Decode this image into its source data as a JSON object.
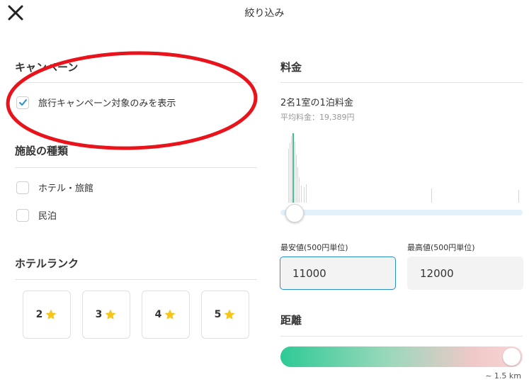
{
  "header": {
    "title": "絞り込み"
  },
  "campaign": {
    "title": "キャンペーン",
    "option_label": "旅行キャンペーン対象のみを表示",
    "checked": true
  },
  "facility": {
    "title": "施設の種類",
    "options": [
      {
        "label": "ホテル・旅館",
        "checked": false
      },
      {
        "label": "民泊",
        "checked": false
      }
    ]
  },
  "rank": {
    "title": "ホテルランク",
    "options": [
      "2",
      "3",
      "4",
      "5"
    ]
  },
  "price": {
    "title": "料金",
    "subtitle": "2名1室の1泊料金",
    "average": "平均料金：19,389円",
    "min_label": "最安値(500円単位)",
    "max_label": "最高値(500円単位)",
    "min_value": "11000",
    "max_value": "12000"
  },
  "distance": {
    "title": "距離",
    "value": "~ 1.5 km"
  },
  "colors": {
    "accent": "#2a8fcb",
    "star": "#f5c518",
    "annotation": "#e8131b",
    "histogram": "#3cc08f"
  }
}
